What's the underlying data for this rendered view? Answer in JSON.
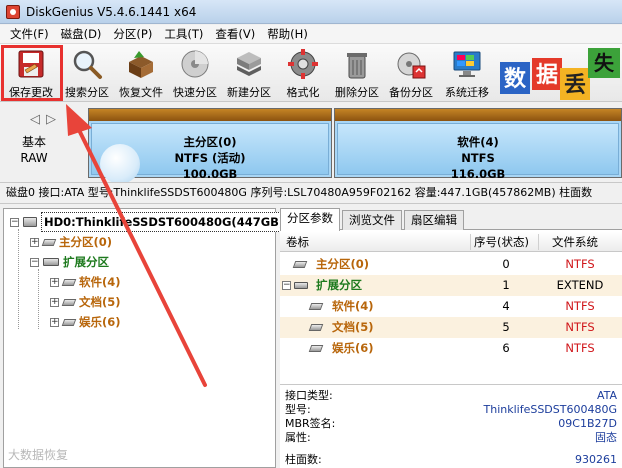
{
  "window": {
    "title": "DiskGenius V5.4.6.1441 x64"
  },
  "menu": {
    "items": [
      "文件(F)",
      "磁盘(D)",
      "分区(P)",
      "工具(T)",
      "查看(V)",
      "帮助(H)"
    ]
  },
  "toolbar": {
    "buttons": [
      {
        "label": "保存更改",
        "icon": "save-changes-icon"
      },
      {
        "label": "搜索分区",
        "icon": "search-partition-icon"
      },
      {
        "label": "恢复文件",
        "icon": "recover-file-icon"
      },
      {
        "label": "快速分区",
        "icon": "quick-partition-icon"
      },
      {
        "label": "新建分区",
        "icon": "new-partition-icon"
      },
      {
        "label": "格式化",
        "icon": "format-icon"
      },
      {
        "label": "删除分区",
        "icon": "delete-partition-icon"
      },
      {
        "label": "备份分区",
        "icon": "backup-partition-icon"
      },
      {
        "label": "系统迁移",
        "icon": "system-migration-icon"
      }
    ],
    "promo": {
      "chars": [
        "数",
        "据",
        "丢",
        "失"
      ]
    }
  },
  "diskbar": {
    "basic_label_line1": "基本",
    "basic_label_line2": "RAW",
    "partitions": [
      {
        "name": "主分区(0)",
        "fs": "NTFS (活动)",
        "size": "100.0GB"
      },
      {
        "name": "软件(4)",
        "fs": "NTFS",
        "size": "116.0GB"
      }
    ]
  },
  "infoline": {
    "text": "磁盘0 接口:ATA  型号:ThinklifeSSDST600480G  序列号:LSL70480A959F02162  容量:447.1GB(457862MB)  柱面数"
  },
  "tree": {
    "disk": "HD0:ThinklifeSSDST600480G(447GB)",
    "primary": "主分区(0)",
    "extended": "扩展分区",
    "logical": [
      "软件(4)",
      "文档(5)",
      "娱乐(6)"
    ]
  },
  "tabs": [
    "分区参数",
    "浏览文件",
    "扇区编辑"
  ],
  "grid": {
    "headers": [
      "卷标",
      "序号(状态)",
      "文件系统"
    ],
    "rows": [
      {
        "label": "主分区(0)",
        "index": "0",
        "fs": "NTFS",
        "kind": "primary"
      },
      {
        "label": "扩展分区",
        "index": "1",
        "fs": "EXTEND",
        "kind": "extended"
      },
      {
        "label": "软件(4)",
        "index": "4",
        "fs": "NTFS",
        "kind": "logical"
      },
      {
        "label": "文档(5)",
        "index": "5",
        "fs": "NTFS",
        "kind": "logical"
      },
      {
        "label": "娱乐(6)",
        "index": "6",
        "fs": "NTFS",
        "kind": "logical"
      }
    ]
  },
  "details": {
    "iface_k": "接口类型:",
    "iface_v": "ATA",
    "model_k": "型号:",
    "model_v": "ThinklifeSSDST600480G",
    "mbr_k": "MBR签名:",
    "mbr_v": "09C1B27D",
    "attr_k": "属性:",
    "attr_v": "固态",
    "cyl_k": "柱面数:",
    "cyl_v": "930261"
  },
  "watermark": "大数据恢复",
  "colors": {
    "highlight": "#e8312f",
    "brown_text": "#b8660b",
    "green_text": "#1e7a1e",
    "ntfs_red": "#d0161a"
  }
}
